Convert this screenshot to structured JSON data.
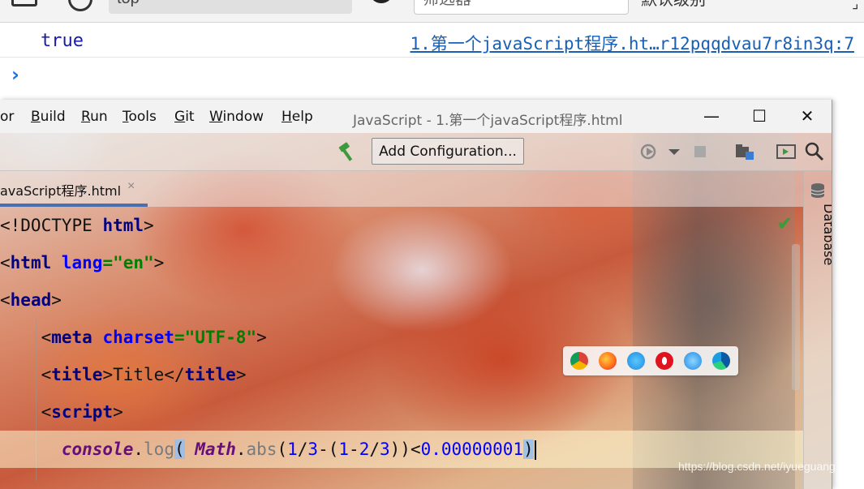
{
  "devtools": {
    "context_label": "top",
    "filter_placeholder": "筛选器",
    "levels_label": "默认级别",
    "console_value": "true",
    "console_link": "1.第一个javaScript程序.ht…r12pqqdvau7r8in3q:7",
    "prompt_symbol": "›"
  },
  "ide": {
    "menu": [
      {
        "label": "or",
        "mnemonic": ""
      },
      {
        "label": "Build",
        "mnemonic": "B"
      },
      {
        "label": "Run",
        "mnemonic": "R"
      },
      {
        "label": "Tools",
        "mnemonic": "T"
      },
      {
        "label": "Git",
        "mnemonic": "G"
      },
      {
        "label": "Window",
        "mnemonic": "W"
      },
      {
        "label": "Help",
        "mnemonic": "H"
      }
    ],
    "window_title": "JavaScript - 1.第一个javaScript程序.html",
    "window_buttons": {
      "minimize": "—",
      "maximize": "☐",
      "close": "✕"
    },
    "toolbar": {
      "add_configuration": "Add Configuration..."
    },
    "tab": {
      "label": "avaScript程序.html",
      "close": "×"
    },
    "side_panel": {
      "database_label": "Database"
    },
    "code_lines": [
      "<!DOCTYPE html>",
      "<html lang=\"en\">",
      "<head>",
      "    <meta charset=\"UTF-8\">",
      "    <title>Title</title>",
      "    <script>",
      "      console.log( Math.abs(1/3-(1-2/3))<0.00000001)"
    ],
    "browser_icons": [
      "chrome-icon",
      "firefox-icon",
      "safari-icon",
      "opera-icon",
      "ie-icon",
      "edge-icon"
    ],
    "colors": {
      "tag": "#000080",
      "attribute": "#0000ff",
      "string": "#008000",
      "keyword": "#660e7a",
      "tab_accent": "#4b6eaf",
      "check_green": "#3f9a3a"
    }
  },
  "watermark": "https://blog.csdn.net/iyueguang"
}
